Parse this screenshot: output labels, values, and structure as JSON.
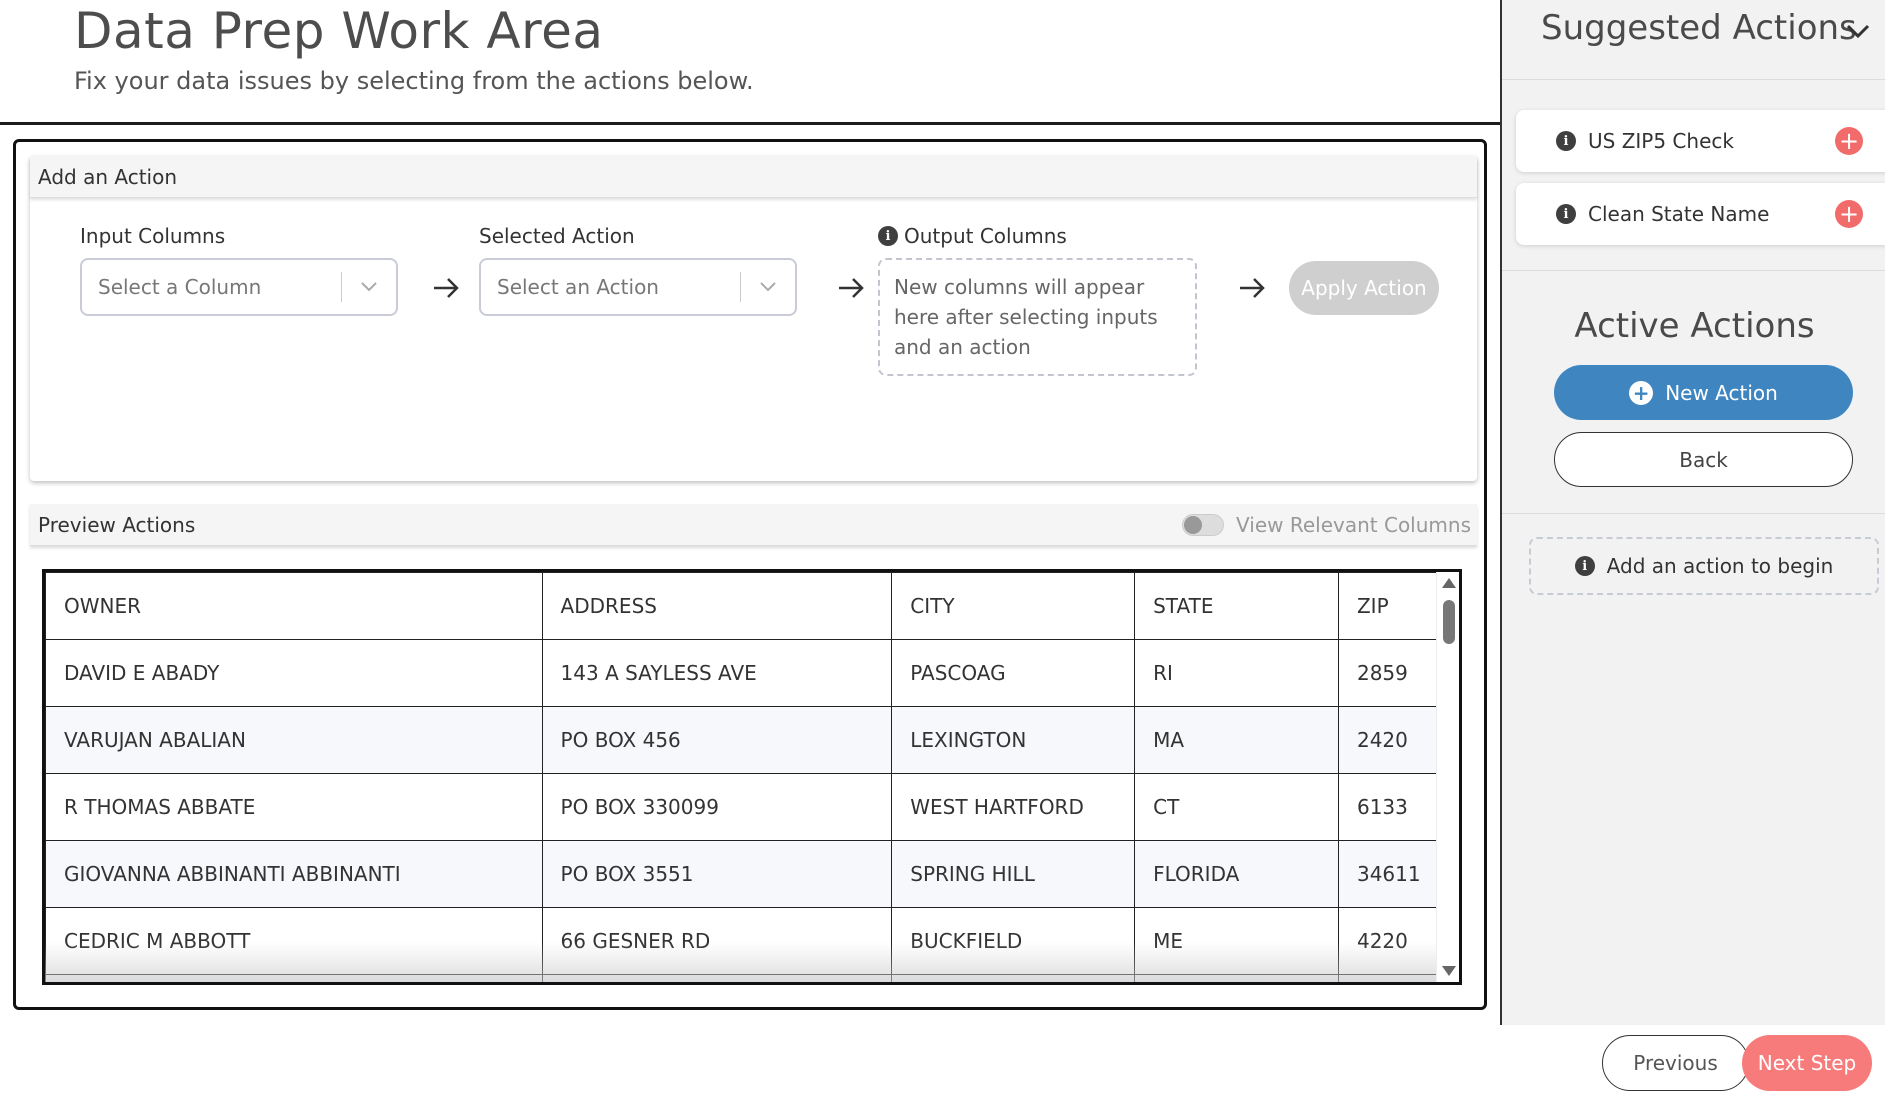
{
  "page": {
    "title": "Data Prep Work Area",
    "subtitle": "Fix your data issues by selecting from the actions below."
  },
  "add_action": {
    "header": "Add an Action",
    "input_columns_label": "Input Columns",
    "input_columns_placeholder": "Select a Column",
    "selected_action_label": "Selected Action",
    "selected_action_placeholder": "Select an Action",
    "output_columns_label": "Output Columns",
    "output_columns_hint": "New columns will appear here after selecting inputs and an action",
    "apply_label": "Apply Action"
  },
  "preview": {
    "header": "Preview Actions",
    "toggle_label": "View Relevant Columns",
    "toggle_on": false,
    "columns": [
      "OWNER",
      "ADDRESS",
      "CITY",
      "STATE",
      "ZIP"
    ],
    "rows": [
      [
        "DAVID E ABADY",
        "143 A SAYLESS AVE",
        "PASCOAG",
        "RI",
        "2859"
      ],
      [
        "VARUJAN ABALIAN",
        "PO BOX 456",
        "LEXINGTON",
        "MA",
        "2420"
      ],
      [
        "R THOMAS ABBATE",
        "PO BOX 330099",
        "WEST HARTFORD",
        "CT",
        "6133"
      ],
      [
        "GIOVANNA ABBINANTI ABBINANTI",
        "PO BOX 3551",
        "SPRING HILL",
        "FLORIDA",
        "34611"
      ],
      [
        "CEDRIC M ABBOTT",
        "66 GESNER RD",
        "BUCKFIELD",
        "ME",
        "4220"
      ]
    ]
  },
  "sidebar": {
    "title": "Suggested Actions",
    "suggestions": [
      {
        "label": "US ZIP5 Check",
        "icon": "info-icon",
        "action_icon": "plus-icon"
      },
      {
        "label": "Clean State Name",
        "icon": "info-icon",
        "action_icon": "plus-icon"
      }
    ],
    "active_title": "Active Actions",
    "new_action_label": "New Action",
    "back_label": "Back",
    "empty_hint": "Add an action to begin"
  },
  "footer": {
    "previous_label": "Previous",
    "next_label": "Next Step"
  },
  "colors": {
    "accent_blue": "#3f86c1",
    "next_coral": "#f77b7b",
    "plus_red": "#f26b6b",
    "apply_disabled": "#cfcfcf"
  }
}
